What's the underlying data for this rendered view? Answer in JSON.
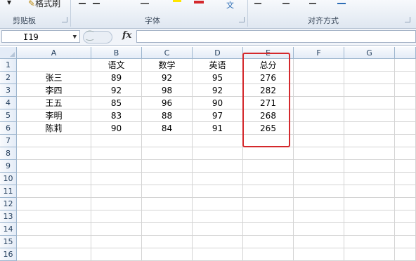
{
  "ribbon": {
    "format_painter_label": "格式刷",
    "groups": [
      {
        "label": "剪贴板"
      },
      {
        "label": "字体"
      },
      {
        "label": "对齐方式"
      }
    ]
  },
  "formula_bar": {
    "name_box": "I19",
    "fx_label": "fx",
    "formula": ""
  },
  "sheet": {
    "columns": [
      "A",
      "B",
      "C",
      "D",
      "E",
      "F",
      "G"
    ],
    "rows": [
      "1",
      "2",
      "3",
      "4",
      "5",
      "6",
      "7",
      "8",
      "9",
      "10",
      "11",
      "12",
      "13",
      "14",
      "15",
      "16"
    ],
    "headers": [
      "",
      "语文",
      "数学",
      "英语",
      "总分"
    ],
    "records": [
      {
        "name": "张三",
        "chinese": "89",
        "math": "92",
        "english": "95",
        "total": "276"
      },
      {
        "name": "李四",
        "chinese": "92",
        "math": "98",
        "english": "92",
        "total": "282"
      },
      {
        "name": "王五",
        "chinese": "85",
        "math": "96",
        "english": "90",
        "total": "271"
      },
      {
        "name": "李明",
        "chinese": "83",
        "math": "88",
        "english": "97",
        "total": "268"
      },
      {
        "name": "陈莉",
        "chinese": "90",
        "math": "84",
        "english": "91",
        "total": "265"
      }
    ]
  },
  "colors": {
    "highlight": "#d4282c",
    "header_bg": "#e4ecf7",
    "gridline": "#d4d4d4"
  }
}
